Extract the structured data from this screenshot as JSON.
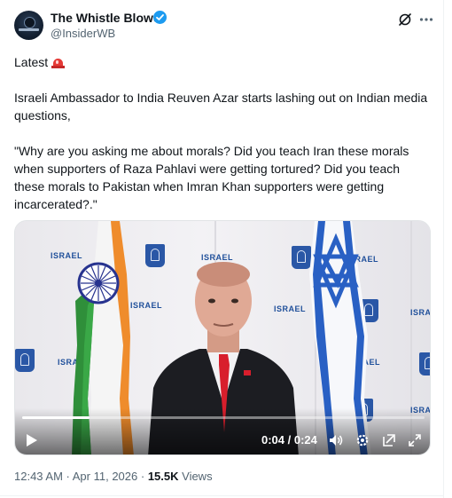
{
  "author": {
    "name": "The Whistle Blower",
    "handle": "@InsiderWB",
    "verified": true
  },
  "tweet": {
    "line_latest": "Latest",
    "paragraph1": "Israeli Ambassador to India Reuven Azar starts lashing out on Indian media questions,",
    "paragraph2": "\"Why are you asking me about morals? Did you teach Iran these morals when supporters of Raza Pahlavi were getting tortured? Did you teach these morals to Pakistan when Imran Khan supporters were getting incarcerated?.\""
  },
  "video": {
    "time_display": "0:04 / 0:24",
    "progress_fraction": 0.1667,
    "backdrop_logo_text": "ISRAEL"
  },
  "footer": {
    "timestamp": "12:43 AM · Apr 11, 2026",
    "separator": " · ",
    "views_count": "15.5K",
    "views_label": " Views"
  },
  "colors": {
    "accent": "#1d9bf0",
    "text_primary": "#0f1419",
    "text_secondary": "#536471"
  },
  "icons": [
    "verified-badge-icon",
    "grok-icon",
    "more-icon",
    "siren-emoji-icon",
    "play-icon",
    "volume-icon",
    "settings-icon",
    "popout-icon",
    "fullscreen-icon"
  ]
}
